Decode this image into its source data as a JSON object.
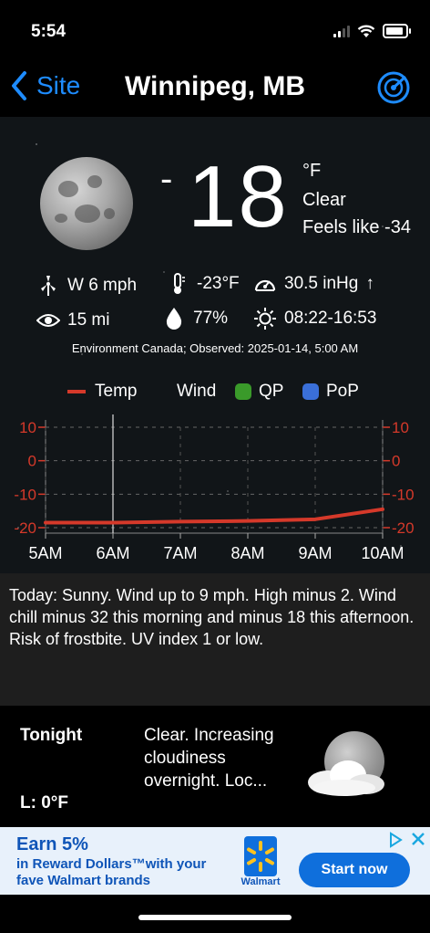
{
  "status_bar": {
    "time": "5:54"
  },
  "nav": {
    "back_label": "Site",
    "title": "Winnipeg, MB"
  },
  "current": {
    "temp_sign": "-",
    "temp": "18",
    "unit": "°F",
    "condition": "Clear",
    "feels_like": "Feels like -34",
    "wind": "W 6 mph",
    "visibility": "15 mi",
    "dew_point": "-23°F",
    "humidity": "77%",
    "pressure": "30.5 inHg",
    "pressure_trend": "↑",
    "sun": "08:22-16:53",
    "observed": "Environment Canada; Observed: 2025-01-14, 5:00 AM"
  },
  "legend": {
    "temp": "Temp",
    "wind": "Wind",
    "qp": "QP",
    "pop": "PoP"
  },
  "colors": {
    "accent": "#1e8cff",
    "temp_line": "#d5392a",
    "qp": "#3a9a2a",
    "pop": "#3a6fd8",
    "ad_text": "#0f55b8",
    "walmart_spark": "#ffc220"
  },
  "chart_data": {
    "type": "line",
    "x": [
      "5AM",
      "6AM",
      "7AM",
      "8AM",
      "9AM",
      "10AM"
    ],
    "series": [
      {
        "name": "Temp",
        "values": [
          -18.5,
          -18.5,
          -18.2,
          -18.0,
          -17.5,
          -14.5
        ]
      }
    ],
    "y_ticks": [
      "10",
      "0",
      "-10",
      "-20"
    ],
    "ylim": [
      -20,
      10
    ],
    "now_marker": "6AM"
  },
  "forecast": {
    "today": "Today:  Sunny. Wind up to 9 mph. High minus 2. Wind chill minus 32 this morning and minus 18 this afternoon. Risk of frostbite. UV index 1 or low.",
    "tonight_label": "Tonight",
    "tonight_low": "L: 0°F",
    "tonight_desc": "Clear. Increasing cloudiness overnight. Loc..."
  },
  "ad": {
    "title": "Earn 5%",
    "line1": "in Reward Dollars™with your",
    "line2": "fave Walmart brands",
    "brand": "Walmart",
    "cta": "Start now"
  }
}
